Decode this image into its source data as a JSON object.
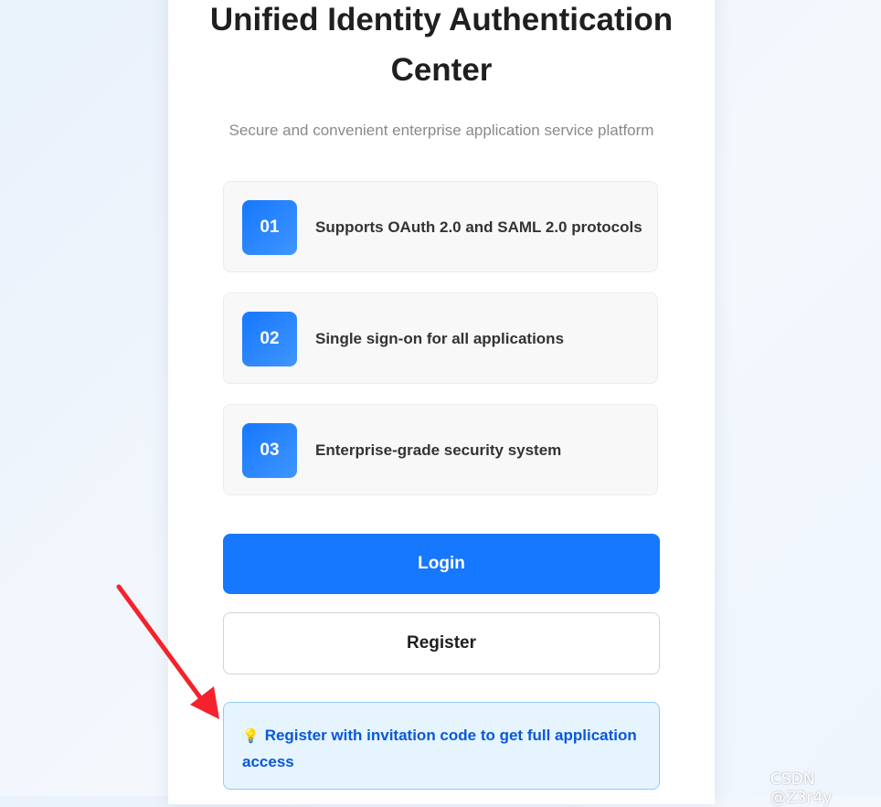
{
  "header": {
    "title": "Unified Identity Authentication Center",
    "subtitle": "Secure and convenient enterprise application service platform"
  },
  "features": [
    {
      "number": "01",
      "text": "Supports OAuth 2.0 and SAML 2.0 protocols"
    },
    {
      "number": "02",
      "text": "Single sign-on for all applications"
    },
    {
      "number": "03",
      "text": "Enterprise-grade security system"
    }
  ],
  "actions": {
    "login_label": "Login",
    "register_label": "Register"
  },
  "hint": {
    "icon": "lightbulb-icon",
    "text": "Register with invitation code to get full application access"
  },
  "watermark": "CSDN @Z3r4y",
  "colors": {
    "primary": "#1677ff",
    "badge_gradient_start": "#1677ff",
    "badge_gradient_end": "#4096ff",
    "hint_background": "#e6f4ff",
    "hint_border": "#91caff",
    "hint_text": "#0958d9",
    "arrow": "#f5222d"
  }
}
